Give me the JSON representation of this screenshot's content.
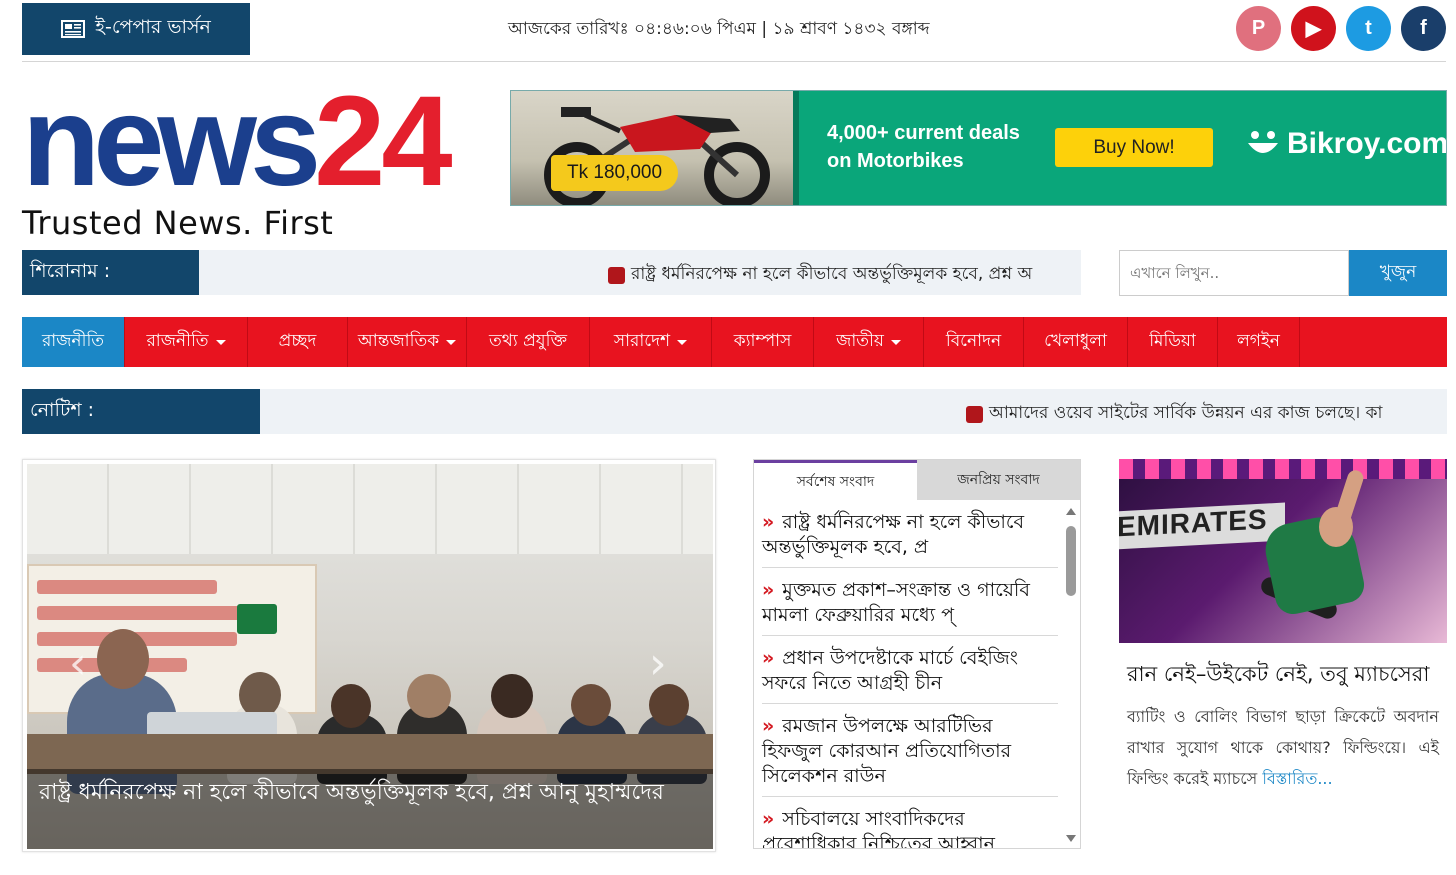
{
  "topbar": {
    "epaper_label": "ই-পেপার ভার্সন",
    "date_text": "আজকের তারিখঃ ০৪:৪৬:০৬ পিএম | ১৯ শ্রাবণ ১৪৩২ বঙ্গাব্দ",
    "socials": [
      {
        "name": "pinterest-icon",
        "glyph": "P",
        "color": "#e0707e"
      },
      {
        "name": "youtube-icon",
        "glyph": "▶",
        "color": "#d0121c"
      },
      {
        "name": "twitter-icon",
        "glyph": "t",
        "color": "#1d9be2"
      },
      {
        "name": "facebook-icon",
        "glyph": "f",
        "color": "#1a3e6a"
      }
    ]
  },
  "logo": {
    "word_news": "news",
    "word_24": "24",
    "tagline": "Trusted News. First",
    "colors": {
      "news": "#1b3f8d",
      "digits": "#e41f2d"
    }
  },
  "ad": {
    "price": "Tk 180,000",
    "deals_line1": "4,000+ current deals",
    "deals_line2": "on Motorbikes",
    "buy_label": "Buy Now!",
    "brand": "Bikroy.com"
  },
  "headline": {
    "label": "শিরোনাম :",
    "ticker": "রাষ্ট্র ধর্মনিরপেক্ষ না হলে কীভাবে অন্তর্ভুক্তিমূলক হবে, প্রশ্ন অ"
  },
  "search": {
    "placeholder": "এখানে লিখুন..",
    "button": "খুজুন"
  },
  "nav": {
    "items": [
      {
        "label": "রাজনীতি",
        "dropdown": false,
        "active": true
      },
      {
        "label": "রাজনীতি",
        "dropdown": true,
        "active": false
      },
      {
        "label": "প্রচ্ছদ",
        "dropdown": false,
        "active": false
      },
      {
        "label": "আন্তজাতিক",
        "dropdown": true,
        "active": false
      },
      {
        "label": "তথ্য প্রযুক্তি",
        "dropdown": false,
        "active": false
      },
      {
        "label": "সারাদেশ",
        "dropdown": true,
        "active": false
      },
      {
        "label": "ক্যাম্পাস",
        "dropdown": false,
        "active": false
      },
      {
        "label": "জাতীয়",
        "dropdown": true,
        "active": false
      },
      {
        "label": "বিনোদন",
        "dropdown": false,
        "active": false
      },
      {
        "label": "খেলাধুলা",
        "dropdown": false,
        "active": false
      },
      {
        "label": "মিডিয়া",
        "dropdown": false,
        "active": false
      },
      {
        "label": "লগইন",
        "dropdown": false,
        "active": false
      }
    ]
  },
  "notice": {
    "label": "নোটিশ :",
    "ticker": "আমাদের ওয়েব সাইটের সার্বিক উন্নয়ন এর কাজ চলছে। কা"
  },
  "lead": {
    "caption": "রাষ্ট্র ধর্মনিরপেক্ষ না হলে কীভাবে অন্তর্ভুক্তিমূলক হবে, প্রশ্ন আনু মুহাম্মদের",
    "prev": "‹",
    "next": "›"
  },
  "tabs": {
    "latest": "সর্বশেষ সংবাদ",
    "popular": "জনপ্রিয় সংবাদ",
    "items": [
      "রাষ্ট্র ধর্মনিরপেক্ষ না হলে কীভাবে অন্তর্ভুক্তিমূলক হবে, প্র",
      "মুক্তমত প্রকাশ–সংক্রান্ত ও গায়েবি মামলা ফেব্রুয়ারির মধ্যে প্",
      "প্রধান উপদেষ্টাকে মার্চে বেইজিং সফরে নিতে আগ্রহী চীন",
      "রমজান উপলক্ষে আরটিভির হিফজুল কোরআন প্রতিযোগিতার সিলেকশন রাউন",
      "সচিবালয়ে সাংবাদিকদের প্রবেশাধিকার নিশ্চিতের আহ্বান"
    ]
  },
  "side": {
    "title": "রান নেই–উইকেট নেই, তবু ম্যাচসেরা",
    "summary": "ব্যাটিং ও বোলিং বিভাগ ছাড়া ক্রিকেটে অবদান রাখার সুযোগ থাকে কোথায়? ফিল্ডিংয়ে। এই ফিল্ডিং করেই ম্যাচসে",
    "more": "বিস্তারিত...",
    "board_text": "EMIRATES"
  }
}
